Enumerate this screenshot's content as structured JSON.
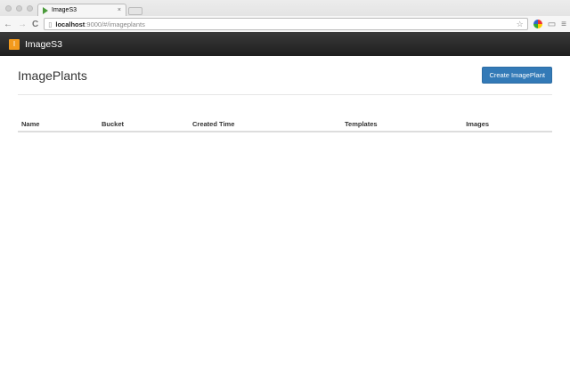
{
  "browser": {
    "tab_title": "ImageS3",
    "url_host": "localhost",
    "url_path": ":9000/#/imageplants",
    "back": "←",
    "forward": "→",
    "reload": "C",
    "close": "×",
    "bookmark": "☆",
    "menu": "≡",
    "cast": "▭"
  },
  "navbar": {
    "logo": "I",
    "brand": "ImageS3"
  },
  "page": {
    "title": "ImagePlants",
    "create_button": "Create ImagePlant"
  },
  "table": {
    "columns": [
      "Name",
      "Bucket",
      "Created Time",
      "Templates",
      "Images"
    ]
  }
}
